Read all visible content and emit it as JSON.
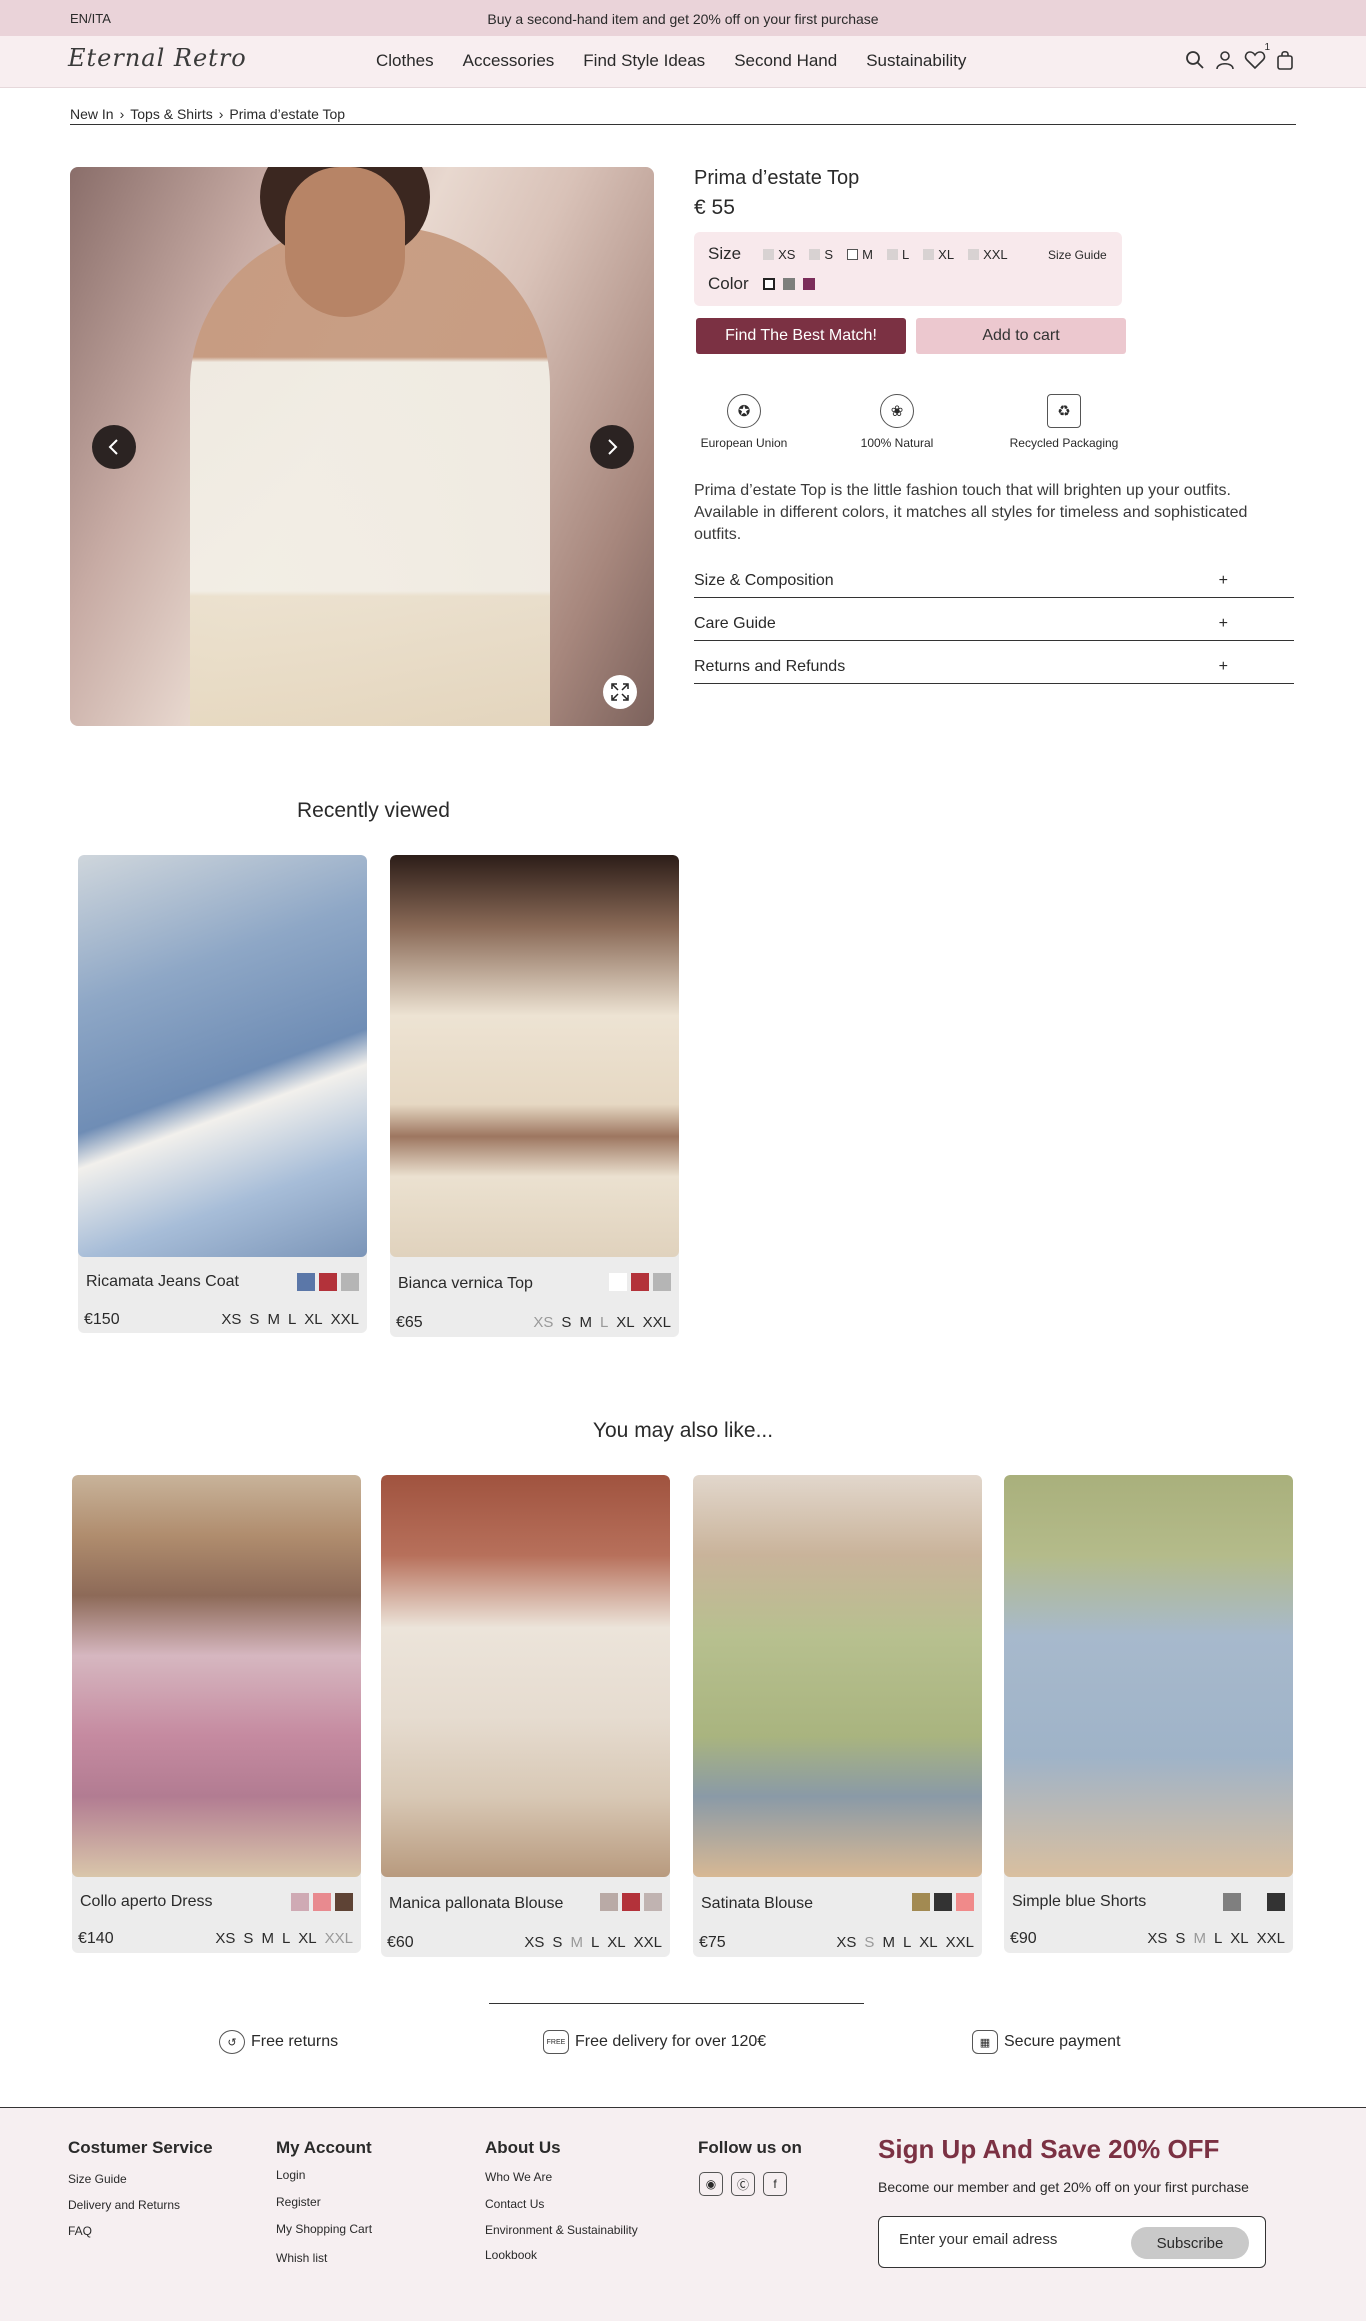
{
  "topbar": {
    "lang": "EN/ITA",
    "promo": "Buy a second-hand item and get 20% off on your first purchase"
  },
  "header": {
    "logo": "Eternal Retro",
    "nav": [
      "Clothes",
      "Accessories",
      "Find Style Ideas",
      "Second Hand",
      "Sustainability"
    ],
    "wishlist_count": "1"
  },
  "breadcrumb": [
    "New In",
    "Tops & Shirts",
    "Prima d’estate Top"
  ],
  "product": {
    "title": "Prima d’estate Top",
    "price": "€ 55",
    "size_label": "Size",
    "sizes": [
      "XS",
      "S",
      "M",
      "L",
      "XL",
      "XXL"
    ],
    "selected_size": "M",
    "size_guide": "Size Guide",
    "color_label": "Color",
    "colors": [
      "#ffffff",
      "#7d7f7c",
      "#7b2d5a"
    ],
    "btn_match": "Find The Best Match!",
    "btn_cart": "Add to cart",
    "features": [
      "European Union",
      "100% Natural",
      "Recycled Packaging"
    ],
    "description": "Prima d’estate Top is the little fashion touch that will brighten up your outfits. Available in different colors, it matches all styles for timeless and sophisticated outfits.",
    "accordions": [
      "Size & Composition",
      "Care Guide",
      "Returns and Refunds"
    ],
    "accordion_icon": "+"
  },
  "recently_viewed": {
    "title": "Recently viewed",
    "items": [
      {
        "name": "Ricamata Jeans Coat",
        "price": "€150",
        "colors": [
          "#5b77a8",
          "#b3323a",
          "#b5b5b5"
        ],
        "sizes": [
          "XS",
          "S",
          "M",
          "L",
          "XL",
          "XXL"
        ],
        "unavailable": []
      },
      {
        "name": "Bianca vernica Top",
        "price": "€65",
        "colors": [
          "#ffffff",
          "#b3323a",
          "#b5b5b5"
        ],
        "sizes": [
          "XS",
          "S",
          "M",
          "L",
          "XL",
          "XXL"
        ],
        "unavailable": [
          "XS",
          "L"
        ]
      }
    ]
  },
  "also_like": {
    "title": "You may also like...",
    "items": [
      {
        "name": "Collo aperto Dress",
        "price": "€140",
        "colors": [
          "#cfaab4",
          "#e88a8f",
          "#5e4335"
        ],
        "sizes": [
          "XS",
          "S",
          "M",
          "L",
          "XL",
          "XXL"
        ],
        "unavailable": [
          "XXL"
        ]
      },
      {
        "name": "Manica pallonata Blouse",
        "price": "€60",
        "colors": [
          "#b9aaa6",
          "#b3323a",
          "#c0b3b1"
        ],
        "sizes": [
          "XS",
          "S",
          "M",
          "L",
          "XL",
          "XXL"
        ],
        "unavailable": [
          "M"
        ]
      },
      {
        "name": "Satinata Blouse",
        "price": "€75",
        "colors": [
          "#a28a52",
          "#333333",
          "#f08a8a"
        ],
        "sizes": [
          "XS",
          "S",
          "M",
          "L",
          "XL",
          "XXL"
        ],
        "unavailable": [
          "S"
        ]
      },
      {
        "name": "Simple blue Shorts",
        "price": "€90",
        "colors": [
          "#7f7f7f",
          "#ececec",
          "#333333"
        ],
        "sizes": [
          "XS",
          "S",
          "M",
          "L",
          "XL",
          "XXL"
        ],
        "unavailable": [
          "M"
        ]
      }
    ]
  },
  "perks": [
    "Free returns",
    "Free delivery for over 120€",
    "Secure payment"
  ],
  "perk_badge": "FREE",
  "footer": {
    "customer_service": {
      "title": "Costumer Service",
      "links": [
        "Size Guide",
        "Delivery and Returns",
        "FAQ"
      ]
    },
    "account": {
      "title": "My Account",
      "links": [
        "Login",
        "Register",
        "My Shopping Cart",
        "Whish list"
      ]
    },
    "about": {
      "title": "About Us",
      "links": [
        "Who We Are",
        "Contact Us",
        "Environment & Sustainability",
        "Lookbook"
      ]
    },
    "follow": {
      "title": "Follow us on"
    },
    "signup": {
      "title": "Sign Up And Save 20% OFF",
      "subtitle": "Become our member and get 20% off on your first purchase",
      "placeholder": "Enter your email adress",
      "button": "Subscribe"
    }
  }
}
